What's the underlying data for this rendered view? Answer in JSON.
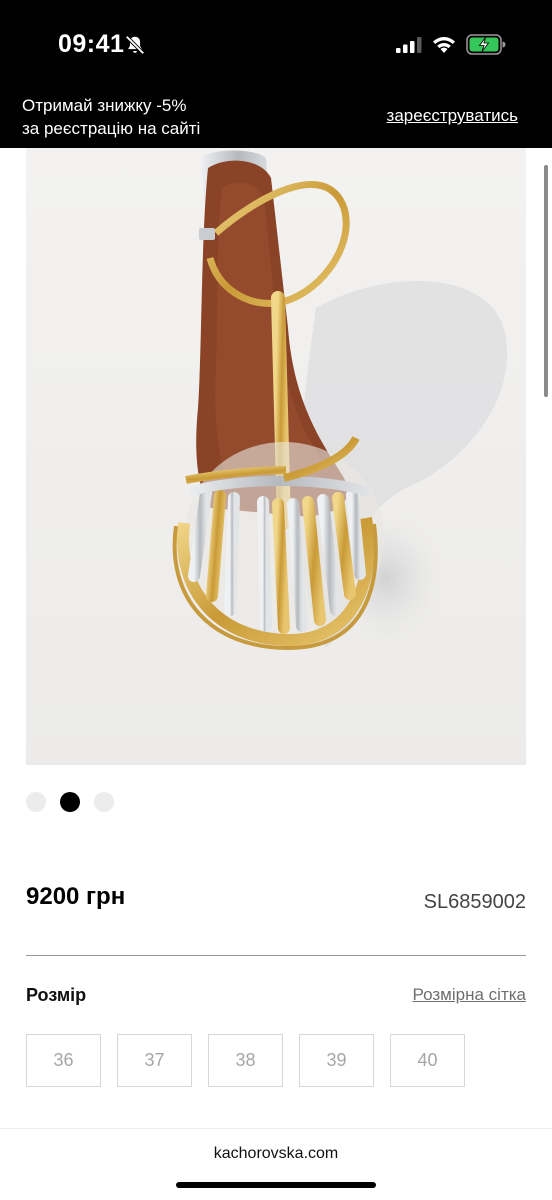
{
  "status_bar": {
    "time": "09:41",
    "icons": [
      "bell-slash-icon",
      "signal-icon",
      "wifi-icon",
      "battery-charging-icon"
    ],
    "battery_color": "#2ecc40"
  },
  "promo": {
    "line1": "Отримай знижку -5%",
    "line2": "за реєстрацію на сайті",
    "link": "зареєструватись"
  },
  "product": {
    "image_alt": "gold and silver strappy sandal",
    "gallery": {
      "total": 3,
      "active_index": 1
    },
    "price": "9200 грн",
    "sku": "SL6859002"
  },
  "size": {
    "label": "Розмір",
    "chart_link": "Розмірна сітка",
    "options": [
      "36",
      "37",
      "38",
      "39",
      "40"
    ]
  },
  "browser": {
    "url": "kachorovska.com"
  },
  "colors": {
    "accent": "#000000",
    "gold": "#d9b352",
    "silver": "#c9ccd0",
    "lining": "#8a4326"
  }
}
